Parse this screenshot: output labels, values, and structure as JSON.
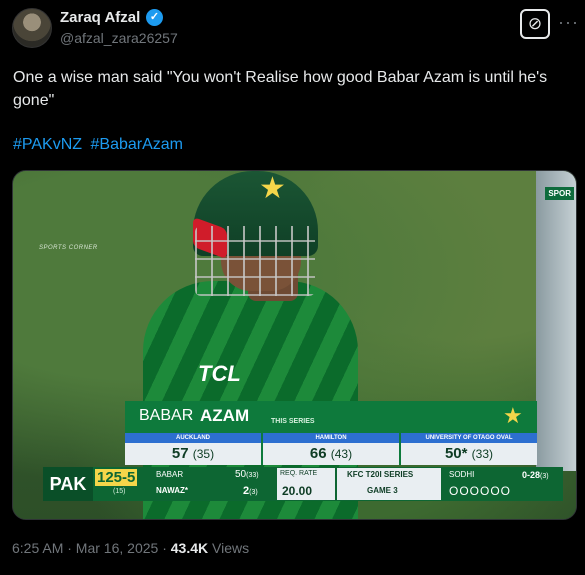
{
  "author": {
    "name": "Zaraq Afzal",
    "handle": "@afzal_zara26257"
  },
  "icons": {
    "verified": "verified-badge-icon",
    "grok": "grok-icon",
    "more": "more-icon"
  },
  "tweet": {
    "text": "One a wise man said \"You won't Realise how good Babar Azam is until he's gone\"",
    "hashtags": [
      "#PAKvNZ",
      "#BabarAzam"
    ]
  },
  "media": {
    "watermark": "SPORTS CORNER",
    "badge": "SPOR",
    "sponsor": "TCL",
    "scorecard": {
      "first_name": "BABAR",
      "last_name": "AZAM",
      "series_label": "THIS SERIES",
      "matches": [
        {
          "venue": "AUCKLAND",
          "score": "57",
          "balls": "(35)"
        },
        {
          "venue": "HAMILTON",
          "score": "66",
          "balls": "(43)"
        },
        {
          "venue": "UNIVERSITY OF OTAGO OVAL",
          "score": "50*",
          "balls": "(33)"
        }
      ]
    },
    "strip": {
      "team": "PAK",
      "total": "125-5",
      "overs": "(15)",
      "batter1": "BABAR",
      "batter1_runs": "50",
      "batter1_balls": "(33)",
      "batter2": "NAWAZ*",
      "batter2_runs": "2",
      "batter2_balls": "(3)",
      "req_rate_label": "REQ. RATE",
      "req_rate": "20.00",
      "series": "KFC T20I SERIES",
      "game": "GAME 3",
      "bowler": "SODHI",
      "bowler_figures": "0-28",
      "bowler_overs": "(3)",
      "balls": "OOOOOO"
    }
  },
  "footer": {
    "time": "6:25 AM · Mar 16, 2025 · ",
    "views": "43.4K",
    "views_label": " Views"
  }
}
